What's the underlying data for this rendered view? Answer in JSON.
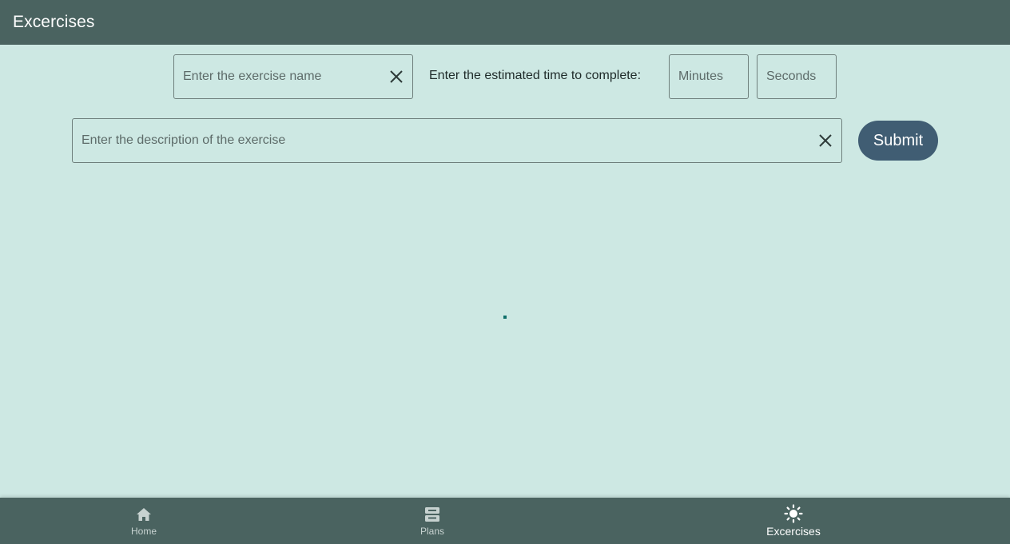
{
  "header": {
    "title": "Excercises"
  },
  "form": {
    "name_placeholder": "Enter the exercise name",
    "time_label": "Enter the estimated time to complete:",
    "minutes_placeholder": "Minutes",
    "seconds_placeholder": "Seconds",
    "description_placeholder": "Enter the description of the exercise",
    "submit_label": "Submit"
  },
  "bottom_nav": {
    "items": [
      {
        "label": "Home",
        "icon": "home-icon",
        "active": false
      },
      {
        "label": "Plans",
        "icon": "inbox-icon",
        "active": false
      },
      {
        "label": "Excercises",
        "icon": "sun-icon",
        "active": true
      }
    ]
  },
  "colors": {
    "app_bar": "#4a6360",
    "background": "#cde8e3",
    "submit_button": "#405d73",
    "nav_active": "#ffffff",
    "nav_inactive": "#c7d2d0",
    "progress_indicator": "#0f6f6a"
  }
}
